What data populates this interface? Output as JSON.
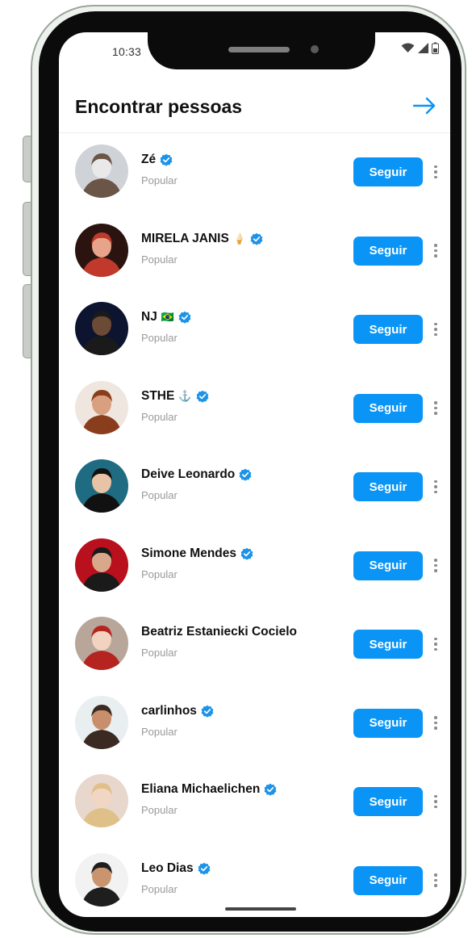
{
  "status_bar": {
    "time": "10:33"
  },
  "header": {
    "title": "Encontrar pessoas",
    "next_icon": "arrow-right-icon"
  },
  "colors": {
    "accent": "#0a95f6",
    "verified": "#1d93e8"
  },
  "people": [
    {
      "name": "Zé",
      "emoji": "",
      "verified": true,
      "subtitle": "Popular",
      "button": "Seguir",
      "avatar_colors": [
        "#cfd3d8",
        "#6b5547",
        "#e9e9e9"
      ]
    },
    {
      "name": "MIRELA JANIS",
      "emoji": "🍦",
      "verified": true,
      "subtitle": "Popular",
      "button": "Seguir",
      "avatar_colors": [
        "#2b1410",
        "#c0392b",
        "#e8a48a"
      ]
    },
    {
      "name": "NJ",
      "emoji": "🇧🇷",
      "verified": true,
      "subtitle": "Popular",
      "button": "Seguir",
      "avatar_colors": [
        "#0d1430",
        "#1a1a1a",
        "#6b4a36"
      ]
    },
    {
      "name": "STHE",
      "emoji": "⚓",
      "verified": true,
      "subtitle": "Popular",
      "button": "Seguir",
      "avatar_colors": [
        "#efe7df",
        "#8a3d1c",
        "#d9a07f"
      ]
    },
    {
      "name": "Deive Leonardo",
      "emoji": "",
      "verified": true,
      "subtitle": "Popular",
      "button": "Seguir",
      "avatar_colors": [
        "#1f6c82",
        "#111111",
        "#e8c3a5"
      ]
    },
    {
      "name": "Simone Mendes",
      "emoji": "",
      "verified": true,
      "subtitle": "Popular",
      "button": "Seguir",
      "avatar_colors": [
        "#b8101c",
        "#1a1a1a",
        "#d9a88a"
      ]
    },
    {
      "name": "Beatriz Estaniecki Cocielo",
      "emoji": "",
      "verified": false,
      "subtitle": "Popular",
      "button": "Seguir",
      "avatar_colors": [
        "#b9a69a",
        "#b5241f",
        "#f1d3c0"
      ]
    },
    {
      "name": "carlinhos",
      "emoji": "",
      "verified": true,
      "subtitle": "Popular",
      "button": "Seguir",
      "avatar_colors": [
        "#e9eef0",
        "#3a2a22",
        "#c98e6b"
      ]
    },
    {
      "name": "Eliana Michaelichen",
      "emoji": "",
      "verified": true,
      "subtitle": "Popular",
      "button": "Seguir",
      "avatar_colors": [
        "#e8d7cc",
        "#e0c089",
        "#f2d6c4"
      ]
    },
    {
      "name": "Leo Dias",
      "emoji": "",
      "verified": true,
      "subtitle": "Popular",
      "button": "Seguir",
      "avatar_colors": [
        "#f2f2f2",
        "#1e1e1e",
        "#c9946e"
      ]
    }
  ]
}
